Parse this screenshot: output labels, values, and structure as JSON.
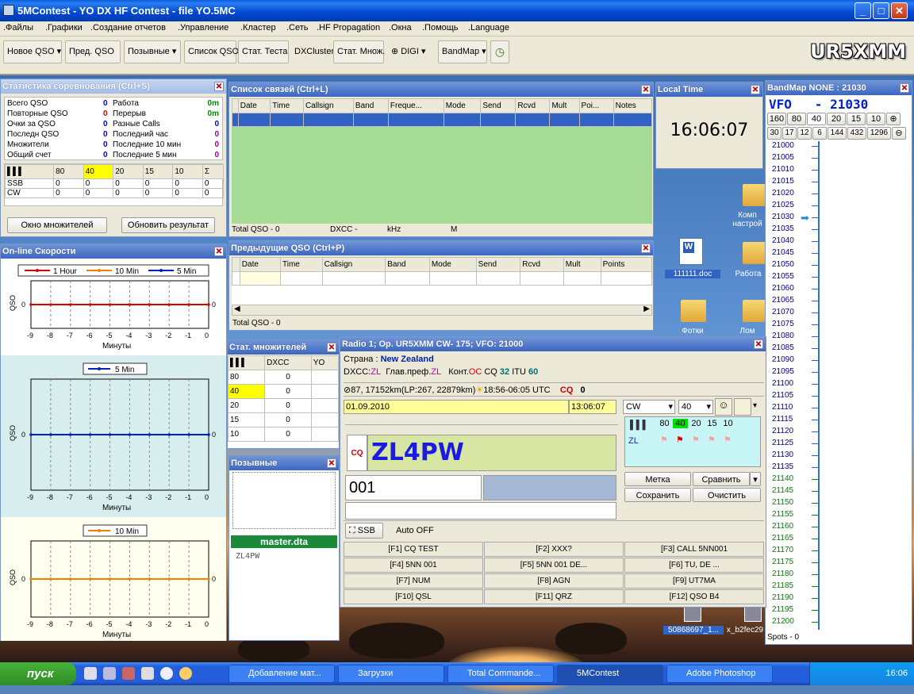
{
  "window": {
    "title": "5MContest - YO DX HF Contest - file YO.5MC"
  },
  "menu": [
    ".Файлы",
    ".Графики",
    ".Создание отчетов",
    ".Управление",
    ".Кластер",
    ".Сеть",
    ".HF Propagation",
    ".Окна",
    ".Помощь",
    ".Language"
  ],
  "toolbar": {
    "new_qso": "Новое QSO",
    "prev_qso": "Пред. QSO",
    "callsigns": "Позывные",
    "qso_list": "Список QSO",
    "stat_test": "Стат. Теста",
    "dxcluster": "DXCluster",
    "stat_mult": "Стат. Множ.",
    "digi": "DIGI",
    "bandmap": "BandMap",
    "operator_call": "UR5XMM"
  },
  "stats": {
    "title": "Статистика соревнования (Ctrl+S)",
    "left": [
      {
        "label": "Всего QSO",
        "value": "0"
      },
      {
        "label": "Повторные QSO",
        "value": "0"
      },
      {
        "label": "Очки за QSO",
        "value": "0"
      },
      {
        "label": "Последн QSO",
        "value": "0"
      },
      {
        "label": "Множители",
        "value": "0"
      },
      {
        "label": "Общий счет",
        "value": "0"
      }
    ],
    "right": [
      {
        "label": "Работа",
        "value": "0m"
      },
      {
        "label": "Перерыв",
        "value": "0m"
      },
      {
        "label": "Разные Calls",
        "value": "0"
      },
      {
        "label": "Последний час",
        "value": "0"
      },
      {
        "label": "Последние 10 мин",
        "value": "0"
      },
      {
        "label": "Последние  5 мин",
        "value": "0"
      }
    ],
    "bands": [
      "80",
      "40",
      "20",
      "15",
      "10"
    ],
    "sigma": "Σ",
    "rows": [
      {
        "mode": "SSB",
        "vals": [
          "0",
          "0",
          "0",
          "0",
          "0"
        ],
        "total": "0"
      },
      {
        "mode": "CW",
        "vals": [
          "0",
          "0",
          "0",
          "0",
          "0"
        ],
        "total": "0"
      }
    ],
    "mult_window_btn": "Окно множителей",
    "refresh_btn": "Обновить результат"
  },
  "speeds": {
    "title": "On-line Скорости",
    "legend1": [
      "1 Hour",
      "10 Min",
      "5 Min"
    ],
    "legend2": "5 Min",
    "legend3": "10 Min",
    "ylabel": "QSO",
    "xlabel": "Минуты",
    "xticks": [
      "-9",
      "-8",
      "-7",
      "-6",
      "-5",
      "-4",
      "-3",
      "-2",
      "-1",
      "0"
    ],
    "zero": "0"
  },
  "qsolist": {
    "title": "Список связей (Ctrl+L)",
    "columns": [
      "Date",
      "Time",
      "Callsign",
      "Band",
      "Freque...",
      "Mode",
      "Send",
      "Rcvd",
      "Mult",
      "Poi...",
      "Notes"
    ],
    "status": [
      "Total QSO - 0",
      "DXCC -",
      "kHz",
      "M"
    ]
  },
  "prevqso": {
    "title": "Предыдущие QSO (Ctrl+P)",
    "columns": [
      "Date",
      "Time",
      "Callsign",
      "Band",
      "Mode",
      "Send",
      "Rcvd",
      "Mult",
      "Points"
    ],
    "status": "Total QSO - 0"
  },
  "localtime": {
    "title": "Local Time",
    "time": "16:06:07"
  },
  "bandmap": {
    "title": "BandMap NONE : 21030",
    "vfo": "VFO   - 21030",
    "bands1": [
      "160",
      "80",
      "40",
      "20",
      "15",
      "10"
    ],
    "bands2": [
      "30",
      "17",
      "12",
      "6",
      "144",
      "432",
      "1296"
    ],
    "freqs": [
      "21000",
      "21005",
      "21010",
      "21015",
      "21020",
      "21025",
      "21030",
      "21035",
      "21040",
      "21045",
      "21050",
      "21055",
      "21060",
      "21065",
      "21070",
      "21075",
      "21080",
      "21085",
      "21090",
      "21095",
      "21100",
      "21105",
      "21110",
      "21115",
      "21120",
      "21125",
      "21130",
      "21135",
      "21140",
      "21145",
      "21150",
      "21155",
      "21160",
      "21165",
      "21170",
      "21175",
      "21180",
      "21185",
      "21190",
      "21195",
      "21200"
    ],
    "spots": "Spots - 0"
  },
  "multstat": {
    "title": "Стат. множителей",
    "col": "DXCC",
    "col2": "YO",
    "rows": [
      {
        "band": "80",
        "v": "0"
      },
      {
        "band": "40",
        "v": "0"
      },
      {
        "band": "20",
        "v": "0"
      },
      {
        "band": "15",
        "v": "0"
      },
      {
        "band": "10",
        "v": "0"
      }
    ]
  },
  "callsigns": {
    "title": "Позывные",
    "db": "master.dta",
    "match": "ZL4PW"
  },
  "radio": {
    "title": "Radio 1; Op. UR5XMM CW- 175; VFO: 21000",
    "country_label": "Страна :",
    "country": "New Zealand",
    "dxcc_label": "DXCC:",
    "dxcc": "ZL",
    "prefix_label": "Глав.преф.",
    "prefix": "ZL",
    "cont_label": "Конт.",
    "cont": "OC",
    "cq_label": "CQ",
    "cq": "32",
    "itu_label": "ITU",
    "itu": "60",
    "path": "87, 17152km(LP:267, 22879km)",
    "sun": "18:56-06:05 UTC",
    "cq_count_label": "CQ",
    "cq_count": "0",
    "date": "01.09.2010",
    "time": "13:06:07",
    "mode": "CW",
    "band": "40",
    "bands": [
      "80",
      "40",
      "20",
      "15",
      "10"
    ],
    "prefix_row": "ZL",
    "cq_tag": "CQ",
    "callsign": "ZL4PW",
    "exchange": "001",
    "mark_btn": "Метка",
    "compare_btn": "Сравнить",
    "save_btn": "Сохранить",
    "clear_btn": "Очистить",
    "ssb_btn": "SSB",
    "auto": "Auto OFF",
    "fkeys": [
      "[F1] CQ TEST",
      "[F2] XXX?",
      "[F3] CALL 5NN001",
      "[F4] 5NN 001",
      "[F5] 5NN 001 DE...",
      "[F6] TU, DE ...",
      "[F7] NUM",
      "[F8] AGN",
      "[F9] UT7MA",
      "[F10] QSL",
      "[F11] QRZ",
      "[F12] QSO B4"
    ]
  },
  "desktop": {
    "icons": [
      "Комп настрой",
      "111111.doc",
      "Работа",
      "Фотки",
      "Лом",
      "50868697_1...",
      "x_b2fec29"
    ]
  },
  "taskbar": {
    "start": "пуск",
    "tasks": [
      "Добавление мат...",
      "Загрузки",
      "Total Commande...",
      "5MContest",
      "Adobe Photoshop"
    ],
    "clock": "16:06"
  }
}
